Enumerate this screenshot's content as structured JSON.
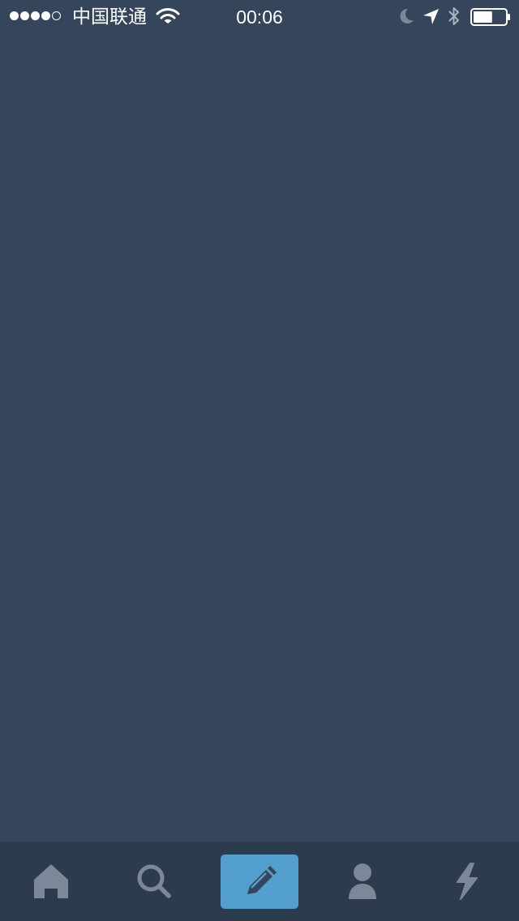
{
  "status_bar": {
    "signal_dots_filled": 4,
    "signal_dots_total": 5,
    "carrier": "中国联通",
    "time": "00:06",
    "battery_level": 0.6,
    "icons": [
      "wifi-icon",
      "moon-icon",
      "location-arrow-icon",
      "bluetooth-icon",
      "battery-icon"
    ]
  },
  "tab_bar": {
    "items": [
      {
        "name": "home",
        "icon": "home-icon"
      },
      {
        "name": "search",
        "icon": "search-icon"
      },
      {
        "name": "compose",
        "icon": "pencil-icon",
        "highlighted": true
      },
      {
        "name": "account",
        "icon": "person-icon"
      },
      {
        "name": "activity",
        "icon": "lightning-icon"
      }
    ]
  },
  "colors": {
    "background": "#35465c",
    "tab_bar_background": "#2d3b4f",
    "tab_icon": "#7c8898",
    "compose_accent": "#529ecc",
    "compose_icon": "#35465c",
    "status_text": "#ffffff"
  }
}
